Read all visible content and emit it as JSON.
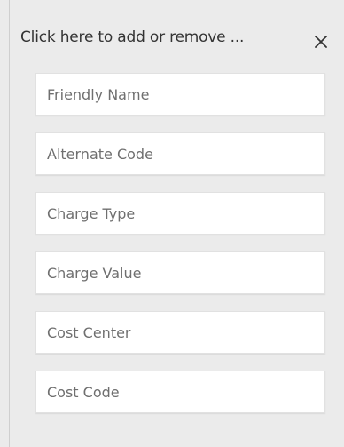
{
  "panel": {
    "title": "Click here to add or remove ...",
    "close_icon": "close-icon",
    "fields": [
      {
        "name": "friendly-name-field",
        "placeholder": "Friendly Name",
        "value": ""
      },
      {
        "name": "alternate-code-field",
        "placeholder": "Alternate Code",
        "value": ""
      },
      {
        "name": "charge-type-field",
        "placeholder": "Charge Type",
        "value": ""
      },
      {
        "name": "charge-value-field",
        "placeholder": "Charge Value",
        "value": ""
      },
      {
        "name": "cost-center-field",
        "placeholder": "Cost Center",
        "value": ""
      },
      {
        "name": "cost-code-field",
        "placeholder": "Cost Code",
        "value": ""
      }
    ]
  },
  "colors": {
    "background": "#ebebeb",
    "field_background": "#ffffff",
    "field_border": "#e1e1e1",
    "text": "#333333",
    "placeholder": "#6f6f6f"
  }
}
